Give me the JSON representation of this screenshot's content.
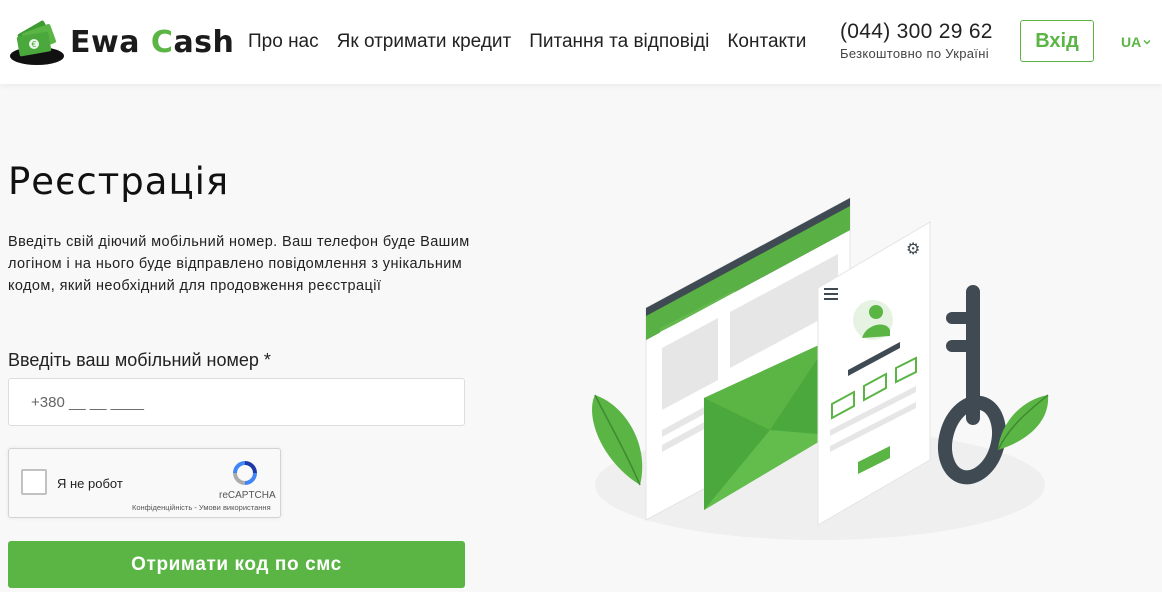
{
  "brand": {
    "name_part1": "Ewa ",
    "name_c": "C",
    "name_part2": "ash"
  },
  "nav": {
    "items": [
      {
        "label": "Про нас"
      },
      {
        "label": "Як отримати кредит"
      },
      {
        "label": "Питання та відповіді"
      },
      {
        "label": "Контакти"
      }
    ]
  },
  "contact": {
    "phone": "(044) 300 29 62",
    "subtitle": "Безкоштовно по Україні"
  },
  "header": {
    "login_label": "Вхід",
    "language": "UA"
  },
  "page": {
    "title": "Реєстрація",
    "description": "Введіть свій діючий мобільний номер. Ваш телефон буде Вашим логіном і на нього буде відправлено повідомлення з унікальним кодом, який необхідний для продовження реєстрації"
  },
  "form": {
    "phone_label": "Введіть ваш мобільний номер *",
    "phone_placeholder": "+380 __ __ ____",
    "phone_value": "",
    "submit_label": "Отримати код по смс"
  },
  "recaptcha": {
    "label": "Я не робот",
    "brand": "reCAPTCHA",
    "terms": "Конфіденційність - Умови використання",
    "checked": false
  },
  "colors": {
    "accent": "#5bb545",
    "accent_dark": "#4a9b38",
    "dark": "#3f4a52"
  },
  "icons": {
    "logo": "money-bills-icon",
    "language_caret": "chevron-down-icon",
    "recaptcha": "recaptcha-logo-icon"
  }
}
